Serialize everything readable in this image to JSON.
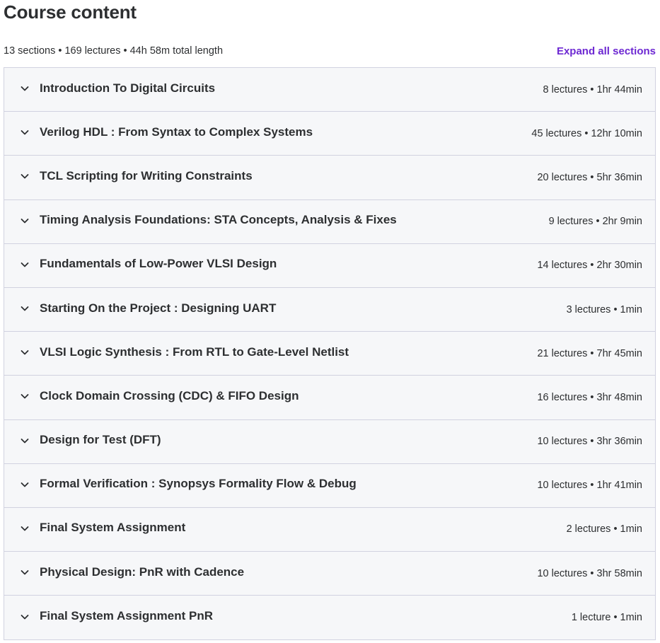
{
  "header": {
    "title": "Course content",
    "summary": "13 sections • 169 lectures • 44h 58m total length",
    "expand_label": "Expand all sections"
  },
  "colors": {
    "accent": "#6d28d2",
    "text": "#2d2f31",
    "section_bg": "#f6f7f9",
    "border": "#d1d2e0"
  },
  "sections": [
    {
      "title": "Introduction To Digital Circuits",
      "meta": "8 lectures • 1hr 44min",
      "icon": "chevron-down-icon"
    },
    {
      "title": "Verilog HDL : From Syntax to Complex Systems",
      "meta": "45 lectures • 12hr 10min",
      "icon": "chevron-down-icon"
    },
    {
      "title": "TCL Scripting for Writing Constraints",
      "meta": "20 lectures • 5hr 36min",
      "icon": "chevron-down-icon"
    },
    {
      "title": "Timing Analysis Foundations: STA Concepts, Analysis & Fixes",
      "meta": "9 lectures • 2hr 9min",
      "icon": "chevron-down-icon"
    },
    {
      "title": "Fundamentals of Low-Power VLSI Design",
      "meta": "14 lectures • 2hr 30min",
      "icon": "chevron-down-icon"
    },
    {
      "title": "Starting On the Project : Designing UART",
      "meta": "3 lectures • 1min",
      "icon": "chevron-down-icon"
    },
    {
      "title": "VLSI Logic Synthesis : From RTL to Gate-Level Netlist",
      "meta": "21 lectures • 7hr 45min",
      "icon": "chevron-down-icon"
    },
    {
      "title": "Clock Domain Crossing (CDC) & FIFO Design",
      "meta": "16 lectures • 3hr 48min",
      "icon": "chevron-down-icon"
    },
    {
      "title": "Design for Test (DFT)",
      "meta": "10 lectures • 3hr 36min",
      "icon": "chevron-down-icon"
    },
    {
      "title": "Formal Verification : Synopsys Formality Flow & Debug",
      "meta": "10 lectures • 1hr 41min",
      "icon": "chevron-down-icon"
    },
    {
      "title": "Final System Assignment",
      "meta": "2 lectures • 1min",
      "icon": "chevron-down-icon"
    },
    {
      "title": "Physical Design: PnR with Cadence",
      "meta": "10 lectures • 3hr 58min",
      "icon": "chevron-down-icon"
    },
    {
      "title": "Final System Assignment PnR",
      "meta": "1 lecture • 1min",
      "icon": "chevron-down-icon"
    }
  ]
}
